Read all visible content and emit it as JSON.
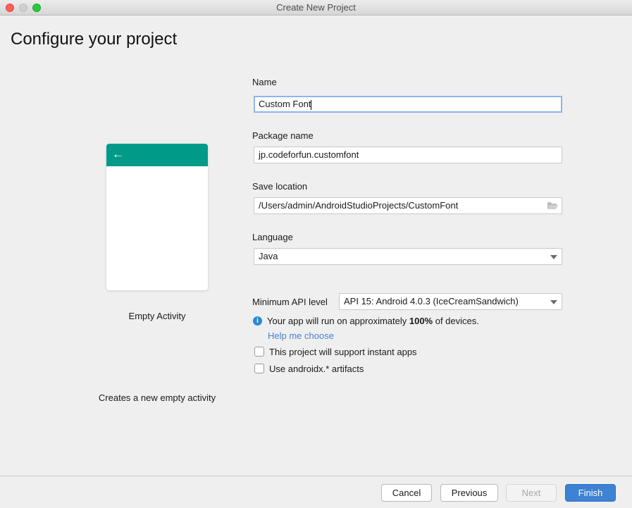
{
  "window": {
    "title": "Create New Project"
  },
  "page": {
    "heading": "Configure your project"
  },
  "template": {
    "name": "Empty Activity",
    "description": "Creates a new empty activity",
    "accent": "#009a88"
  },
  "form": {
    "name_label": "Name",
    "name_value": "Custom Font",
    "package_label": "Package name",
    "package_value": "jp.codeforfun.customfont",
    "location_label": "Save location",
    "location_value": "/Users/admin/AndroidStudioProjects/CustomFont",
    "language_label": "Language",
    "language_value": "Java",
    "api_label": "Minimum API level",
    "api_value": "API 15: Android 4.0.3 (IceCreamSandwich)",
    "info_prefix": "Your app will run on approximately ",
    "info_percent": "100%",
    "info_suffix": " of devices.",
    "help_link": "Help me choose",
    "instant_apps_label": "This project will support instant apps",
    "instant_apps_checked": false,
    "androidx_label": "Use androidx.* artifacts",
    "androidx_checked": false
  },
  "buttons": {
    "cancel": "Cancel",
    "previous": "Previous",
    "next": "Next",
    "finish": "Finish",
    "primary_color": "#3d82d4"
  }
}
